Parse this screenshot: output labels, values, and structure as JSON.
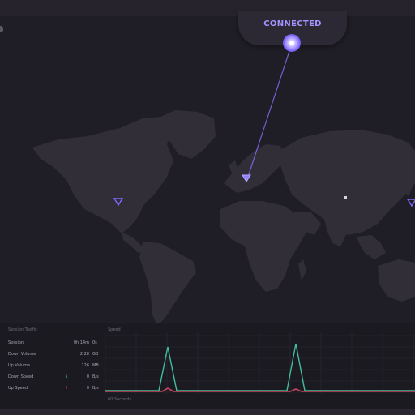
{
  "status": {
    "label": "CONNECTED",
    "accent_color": "#8c7bff"
  },
  "map": {
    "server_pins": [
      {
        "name": "north-america-pin-icon",
        "color": "#7b6bff"
      },
      {
        "name": "europe-pin-icon",
        "color": "#7b6bff"
      },
      {
        "name": "asia-marker",
        "color": "#d8d4dd"
      },
      {
        "name": "east-asia-pin-icon",
        "color": "#7b6bff"
      }
    ]
  },
  "session_traffic": {
    "title": "Session Traffic",
    "rows": [
      {
        "label": "Session",
        "arrow": "",
        "value": "0h 14m",
        "unit": "0s"
      },
      {
        "label": "Down Volume",
        "arrow": "",
        "value": "2.28",
        "unit": "GB"
      },
      {
        "label": "Up Volume",
        "arrow": "",
        "value": "126",
        "unit": "MB"
      },
      {
        "label": "Down Speed",
        "arrow": "↓",
        "value": "0",
        "unit": "B/s"
      },
      {
        "label": "Up Speed",
        "arrow": "↑",
        "value": "0",
        "unit": "B/s"
      }
    ]
  },
  "speed_graph": {
    "title": "Speed",
    "footer": "60 Seconds",
    "down_color": "#3fbf9a",
    "up_color": "#c94561"
  }
}
